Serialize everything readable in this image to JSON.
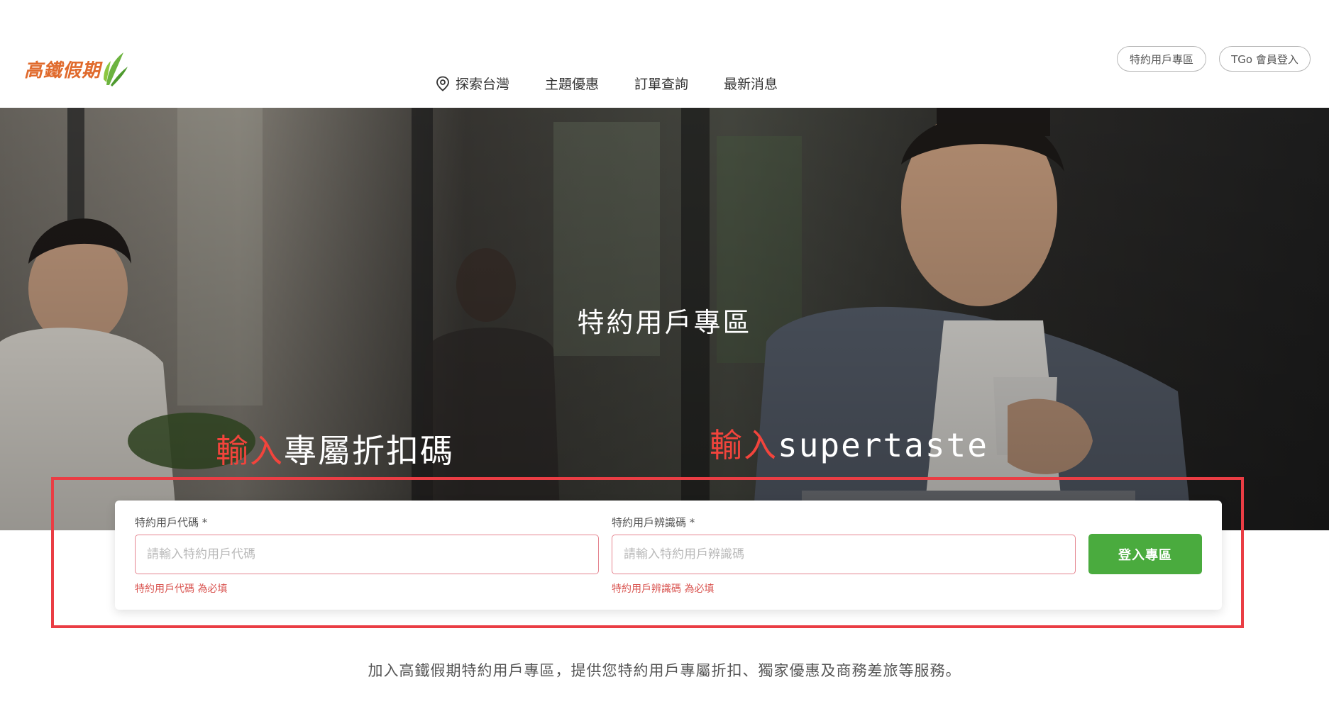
{
  "brand": {
    "name": "高鐵假期",
    "color": "#e06a2c",
    "leaf_color": "#6cb33f"
  },
  "nav": {
    "items": [
      {
        "label": "探索台灣",
        "icon": "map-pin-icon"
      },
      {
        "label": "主題優惠"
      },
      {
        "label": "訂單查詢"
      },
      {
        "label": "最新消息"
      }
    ]
  },
  "top_buttons": {
    "special_zone": "特約用戶專區",
    "tgo_login": "TGo 會員登入"
  },
  "hero": {
    "title": "特約用戶專區"
  },
  "annotations": {
    "left": {
      "red": "輸入",
      "rest": "專屬折扣碼"
    },
    "right": {
      "red": "輸入",
      "rest": "supertaste"
    },
    "highlight_color": "#ea3d44"
  },
  "form": {
    "code_field": {
      "label": "特約用戶代碼 *",
      "placeholder": "請輸入特約用戶代碼",
      "value": "",
      "error": "特約用戶代碼 為必填"
    },
    "id_field": {
      "label": "特約用戶辨識碼 *",
      "placeholder": "請輸入特約用戶辨識碼",
      "value": "",
      "error": "特約用戶辨識碼 為必填"
    },
    "submit_label": "登入專區",
    "submit_color": "#4aab3e"
  },
  "footer": {
    "description": "加入高鐵假期特約用戶專區，提供您特約用戶專屬折扣、獨家優惠及商務差旅等服務。"
  }
}
